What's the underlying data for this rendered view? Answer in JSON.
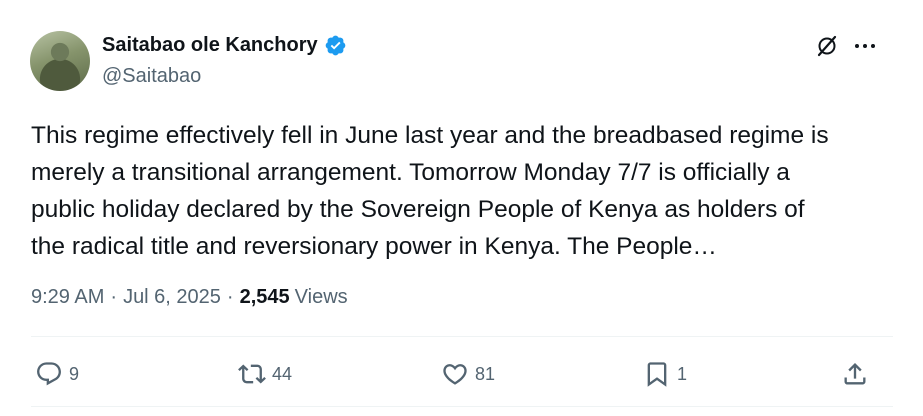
{
  "author": {
    "name": "Saitabao ole Kanchory",
    "handle": "@Saitabao",
    "verified": true,
    "verified_color": "#1d9bf0"
  },
  "tweet": {
    "text": "This regime effectively fell in June last year and the breadbased regime is\nmerely a transitional arrangement. Tomorrow Monday 7/7 is officially a\npublic holiday declared by the Sovereign People of Kenya as holders of\nthe radical title and reversionary power in Kenya. The People…",
    "time": "9:29 AM",
    "date": "Jul 6, 2025",
    "separator": "·",
    "views_count": "2,545",
    "views_label": "Views"
  },
  "actions": {
    "replies": "9",
    "reposts": "44",
    "likes": "81",
    "bookmarks": "1"
  },
  "icons": {
    "grok": "grok-icon",
    "more": "more-dots-icon",
    "reply": "reply-icon",
    "repost": "repost-icon",
    "like": "heart-icon",
    "bookmark": "bookmark-icon",
    "share": "share-icon"
  },
  "colors": {
    "text": "#0f1419",
    "secondary": "#536471",
    "divider": "#eff3f4"
  }
}
